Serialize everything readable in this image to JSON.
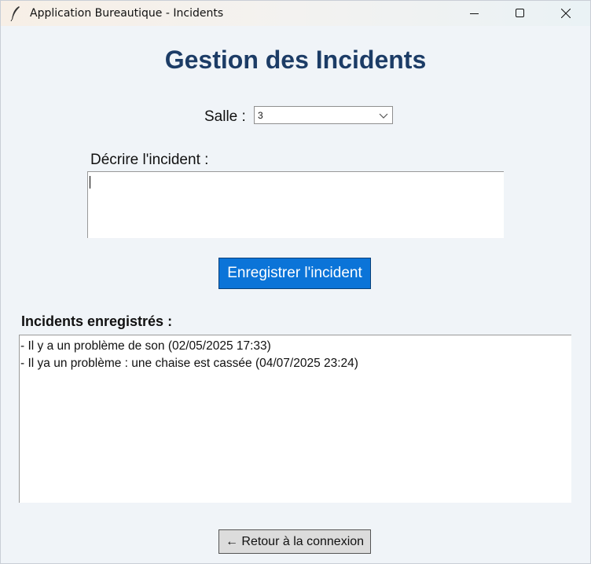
{
  "window": {
    "title": "Application Bureautique - Incidents",
    "app_icon": "feather-icon"
  },
  "page": {
    "title": "Gestion des Incidents"
  },
  "form": {
    "salle_label": "Salle :",
    "salle_value": "3",
    "description_label": "Décrire l'incident :",
    "description_value": "",
    "save_button_label": "Enregistrer l'incident"
  },
  "incidents": {
    "heading": "Incidents enregistrés :",
    "items": [
      "- Il y a un problème de son (02/05/2025 17:33)",
      "- Il ya un problème : une chaise est cassée (04/07/2025 23:24)"
    ]
  },
  "footer": {
    "back_button_label": "← Retour à la connexion"
  },
  "colors": {
    "title": "#1c3c66",
    "primary_button": "#0b74d8",
    "background": "#f0f4f8"
  }
}
